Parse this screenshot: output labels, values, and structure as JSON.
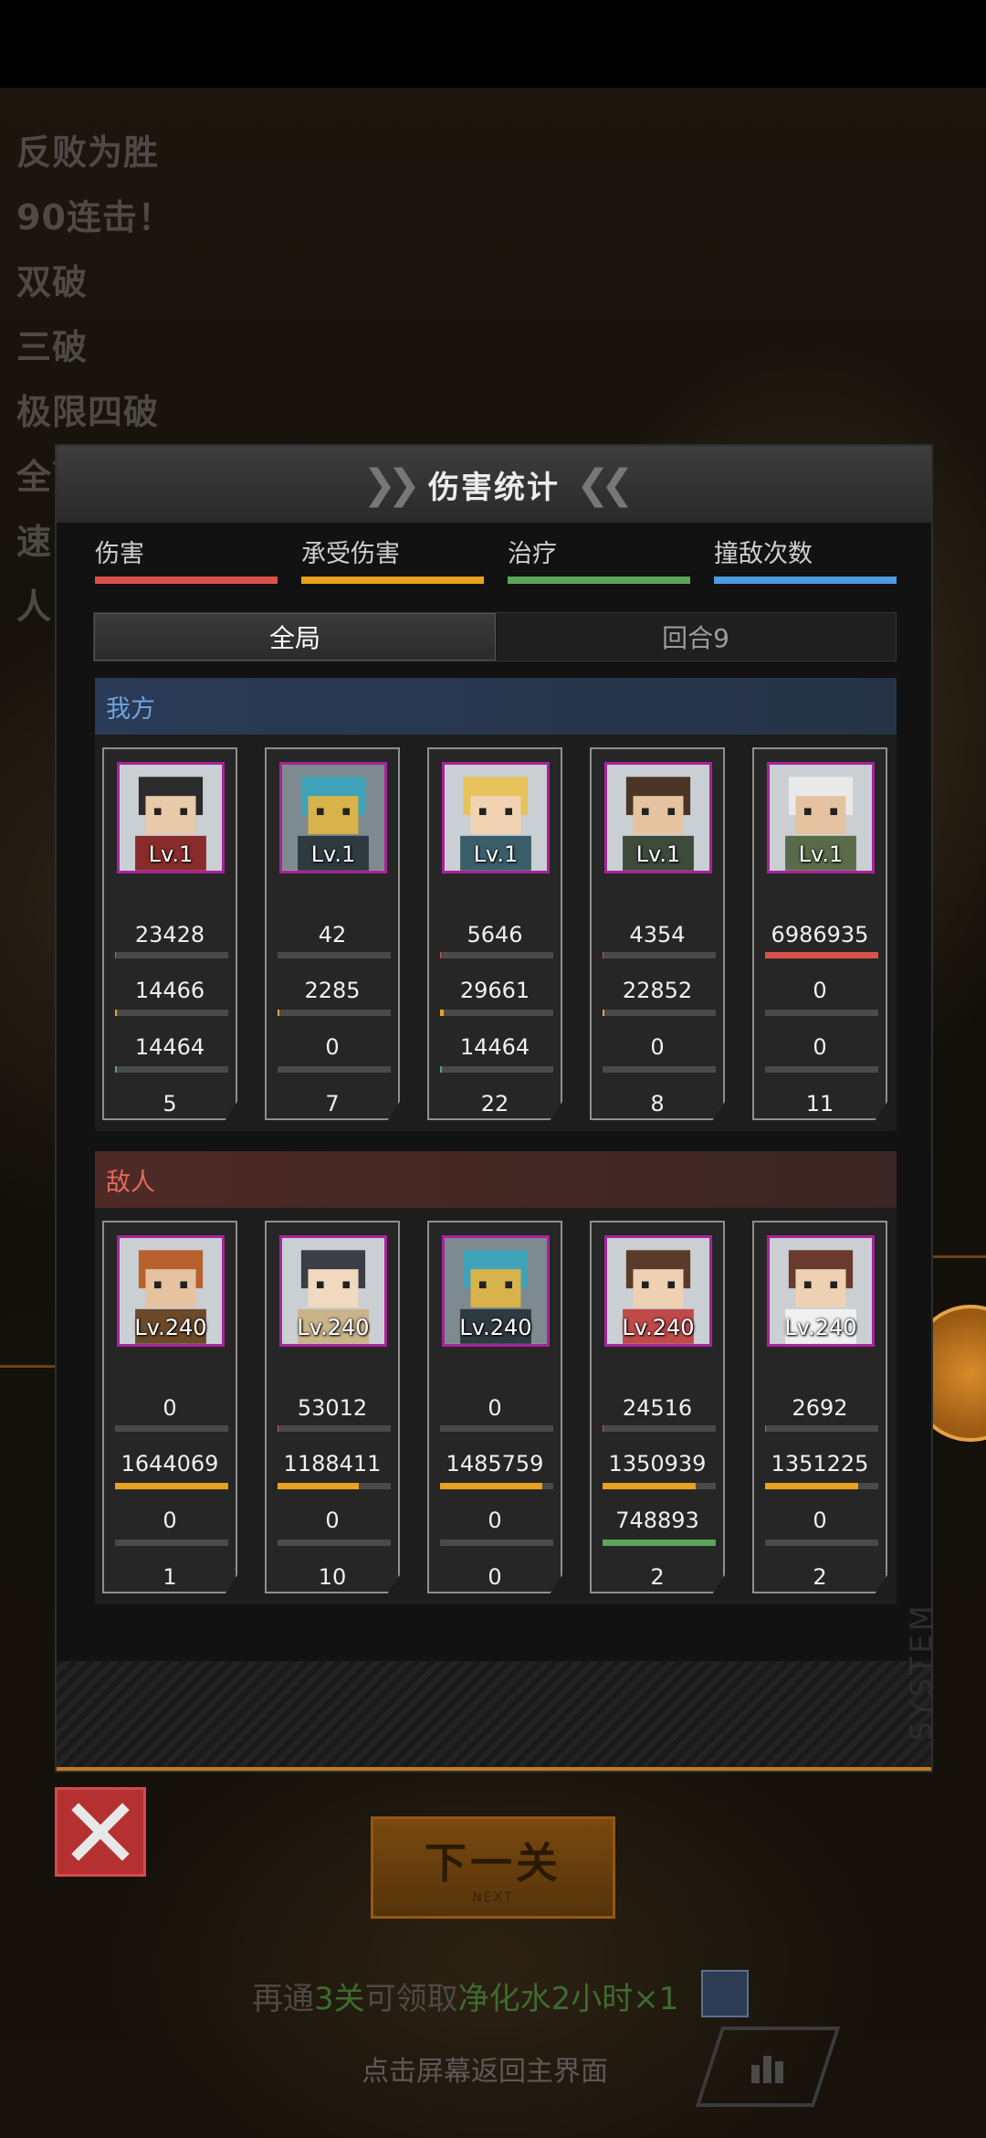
{
  "background": {
    "combo_texts": [
      "反败为胜",
      "90连击！",
      "双破",
      "三破",
      "极限四破",
      "全面",
      "速",
      "人"
    ]
  },
  "modal": {
    "title": "伤害统计",
    "legend": [
      {
        "label": "伤害",
        "color": "#d9534a"
      },
      {
        "label": "承受伤害",
        "color": "#e8a21f"
      },
      {
        "label": "治疗",
        "color": "#5aa65a"
      },
      {
        "label": "撞敌次数",
        "color": "#4d9be0"
      }
    ],
    "tabs": [
      {
        "label": "全局",
        "active": true
      },
      {
        "label": "回合9",
        "active": false
      }
    ],
    "our_side": {
      "label": "我方",
      "units": [
        {
          "level": "Lv.1",
          "damage": "23428",
          "taken": "14466",
          "heal": "14464",
          "hits": "5",
          "damage_fill": 0.003,
          "taken_fill": 0.02,
          "heal_fill": 0.02,
          "hits_fill": 0.23,
          "portrait": "cat-eared-girl-icon"
        },
        {
          "level": "Lv.1",
          "damage": "42",
          "taken": "2285",
          "heal": "0",
          "hits": "7",
          "damage_fill": 0.0,
          "taken_fill": 0.02,
          "heal_fill": 0.0,
          "hits_fill": 0.32,
          "portrait": "robot-mech-icon"
        },
        {
          "level": "Lv.1",
          "damage": "5646",
          "taken": "29661",
          "heal": "14464",
          "hits": "22",
          "damage_fill": 0.001,
          "taken_fill": 0.03,
          "heal_fill": 0.02,
          "hits_fill": 1.0,
          "portrait": "blonde-pilot-icon"
        },
        {
          "level": "Lv.1",
          "damage": "4354",
          "taken": "22852",
          "heal": "0",
          "hits": "8",
          "damage_fill": 0.001,
          "taken_fill": 0.02,
          "heal_fill": 0.0,
          "hits_fill": 0.36,
          "portrait": "dark-hair-soldier-icon"
        },
        {
          "level": "Lv.1",
          "damage": "6986935",
          "taken": "0",
          "heal": "0",
          "hits": "11",
          "damage_fill": 1.0,
          "taken_fill": 0.0,
          "heal_fill": 0.0,
          "hits_fill": 0.5,
          "portrait": "white-hair-sniper-icon"
        }
      ]
    },
    "enemy_side": {
      "label": "敌人",
      "units": [
        {
          "level": "Lv.240",
          "damage": "0",
          "taken": "1644069",
          "heal": "0",
          "hits": "1",
          "damage_fill": 0.0,
          "taken_fill": 1.0,
          "heal_fill": 0.0,
          "hits_fill": 0.04,
          "portrait": "ginger-warrior-icon"
        },
        {
          "level": "Lv.240",
          "damage": "53012",
          "taken": "1188411",
          "heal": "0",
          "hits": "10",
          "damage_fill": 0.01,
          "taken_fill": 0.72,
          "heal_fill": 0.0,
          "hits_fill": 0.45,
          "portrait": "hooded-girl-icon"
        },
        {
          "level": "Lv.240",
          "damage": "0",
          "taken": "1485759",
          "heal": "0",
          "hits": "0",
          "damage_fill": 0.0,
          "taken_fill": 0.9,
          "heal_fill": 0.0,
          "hits_fill": 0.0,
          "portrait": "robot-mech-icon"
        },
        {
          "level": "Lv.240",
          "damage": "24516",
          "taken": "1350939",
          "heal": "748893",
          "hits": "2",
          "damage_fill": 0.005,
          "taken_fill": 0.82,
          "heal_fill": 1.0,
          "hits_fill": 0.09,
          "portrait": "brunette-medic-icon"
        },
        {
          "level": "Lv.240",
          "damage": "2692",
          "taken": "1351225",
          "heal": "0",
          "hits": "2",
          "damage_fill": 0.001,
          "taken_fill": 0.82,
          "heal_fill": 0.0,
          "hits_fill": 0.09,
          "portrait": "bow-girl-icon"
        }
      ]
    }
  },
  "footer": {
    "next_button": "下一关",
    "next_sub": "NEXT",
    "reward_parts": [
      "再通",
      "3关",
      "可领取",
      "净化水2小时×1"
    ],
    "hint": "点击屏幕返回主界面",
    "system_watermark": "SYSTEM"
  }
}
